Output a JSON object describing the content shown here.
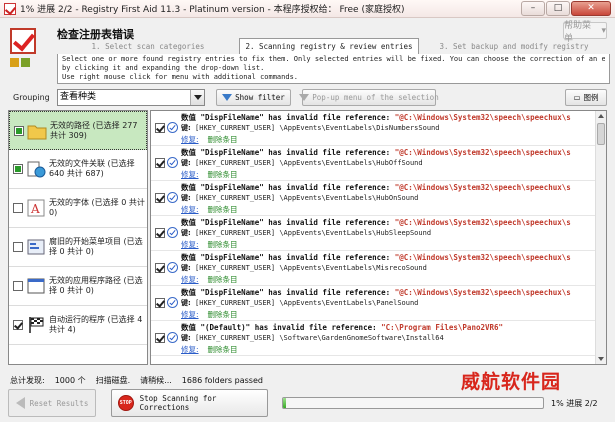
{
  "window": {
    "title": "1% 进展 2/2 - Registry First Aid 11.3 - Platinum version - 本程序授权给： Free (家庭授权)",
    "minimize": "–",
    "maximize": "□",
    "close": "✕"
  },
  "header": {
    "title": "检查注册表错误",
    "help_label": "帮助菜单"
  },
  "steps": [
    {
      "label": "1. Select scan categories"
    },
    {
      "label": "2. Scanning registry & review entries"
    },
    {
      "label": "3. Set backup and modify registry"
    }
  ],
  "description": [
    "Select one or more found registry entries to fix them. Only selected entries will be fixed. You can choose the correction of an entry",
    "by clicking it and expanding the drop-down list.",
    "Use right mouse click for menu with additional commands."
  ],
  "toolbar": {
    "grouping_label": "Grouping",
    "grouping_value": "查看种类",
    "show_filter": "Show filter",
    "popup_menu": "Pop-up menu of the selection",
    "legend": "图例"
  },
  "categories": [
    {
      "label": "无效的路径 (已选择 277 共计 309)",
      "state": "partial",
      "selected": true
    },
    {
      "label": "无效的文件关联 (已选择 640 共计 687)",
      "state": "partial",
      "selected": false
    },
    {
      "label": "无效的字体 (已选择 0 共计 0)",
      "state": "none",
      "selected": false
    },
    {
      "label": "腐旧的开始菜单项目 (已选择 0 共计 0)",
      "state": "none",
      "selected": false
    },
    {
      "label": "无效的应用程序路径 (已选择 0 共计 0)",
      "state": "none",
      "selected": false
    },
    {
      "label": "自动运行的程序 (已选择 4 共计 4)",
      "state": "checked",
      "selected": false
    }
  ],
  "entries": [
    {
      "prefix": "数值",
      "name": "\"DispFileName\"",
      "mid": " has invalid file reference: ",
      "value": "\"@C:\\Windows\\System32\\speech\\speechux\\s",
      "key_label": "键:",
      "key": " [HKEY_CURRENT_USER] \\AppEvents\\EventLabels\\DisNumbersSound",
      "fix": "修复:",
      "action": "删除条目"
    },
    {
      "prefix": "数值",
      "name": "\"DispFileName\"",
      "mid": " has invalid file reference: ",
      "value": "\"@C:\\Windows\\System32\\speech\\speechux\\s",
      "key_label": "键:",
      "key": " [HKEY_CURRENT_USER] \\AppEvents\\EventLabels\\HubOffSound",
      "fix": "修复:",
      "action": "删除条目"
    },
    {
      "prefix": "数值",
      "name": "\"DispFileName\"",
      "mid": " has invalid file reference: ",
      "value": "\"@C:\\Windows\\System32\\speech\\speechux\\s",
      "key_label": "键:",
      "key": " [HKEY_CURRENT_USER] \\AppEvents\\EventLabels\\HubOnSound",
      "fix": "修复:",
      "action": "删除条目"
    },
    {
      "prefix": "数值",
      "name": "\"DispFileName\"",
      "mid": " has invalid file reference: ",
      "value": "\"@C:\\Windows\\System32\\speech\\speechux\\s",
      "key_label": "键:",
      "key": " [HKEY_CURRENT_USER] \\AppEvents\\EventLabels\\HubSleepSound",
      "fix": "修复:",
      "action": "删除条目"
    },
    {
      "prefix": "数值",
      "name": "\"DispFileName\"",
      "mid": " has invalid file reference: ",
      "value": "\"@C:\\Windows\\System32\\speech\\speechux\\s",
      "key_label": "键:",
      "key": " [HKEY_CURRENT_USER] \\AppEvents\\EventLabels\\MisrecoSound",
      "fix": "修复:",
      "action": "删除条目"
    },
    {
      "prefix": "数值",
      "name": "\"DispFileName\"",
      "mid": " has invalid file reference: ",
      "value": "\"@C:\\Windows\\System32\\speech\\speechux\\s",
      "key_label": "键:",
      "key": " [HKEY_CURRENT_USER] \\AppEvents\\EventLabels\\PanelSound",
      "fix": "修复:",
      "action": "删除条目"
    },
    {
      "prefix": "数值",
      "name": "\"(Default)\"",
      "mid": " has invalid file reference: ",
      "value": "\"C:\\Program Files\\Pano2VR6\"",
      "key_label": "键:",
      "key": " [HKEY_CURRENT_USER] \\Software\\GardenGnomeSoftware\\Install64",
      "fix": "修复:",
      "action": "删除条目"
    }
  ],
  "status": {
    "found_label": "总计发现:",
    "found_value": "1000 个",
    "scanning_label": "扫描磁盘.",
    "wait_label": "请稍候...",
    "folders_passed": "1686 folders passed"
  },
  "watermark": "威航软件园",
  "bottom": {
    "reset": "Reset Results",
    "stop": "Stop Scanning for Corrections",
    "stop_icon_text": "STOP",
    "progress_label": "1% 进展 2/2",
    "progress_percent": 1
  }
}
